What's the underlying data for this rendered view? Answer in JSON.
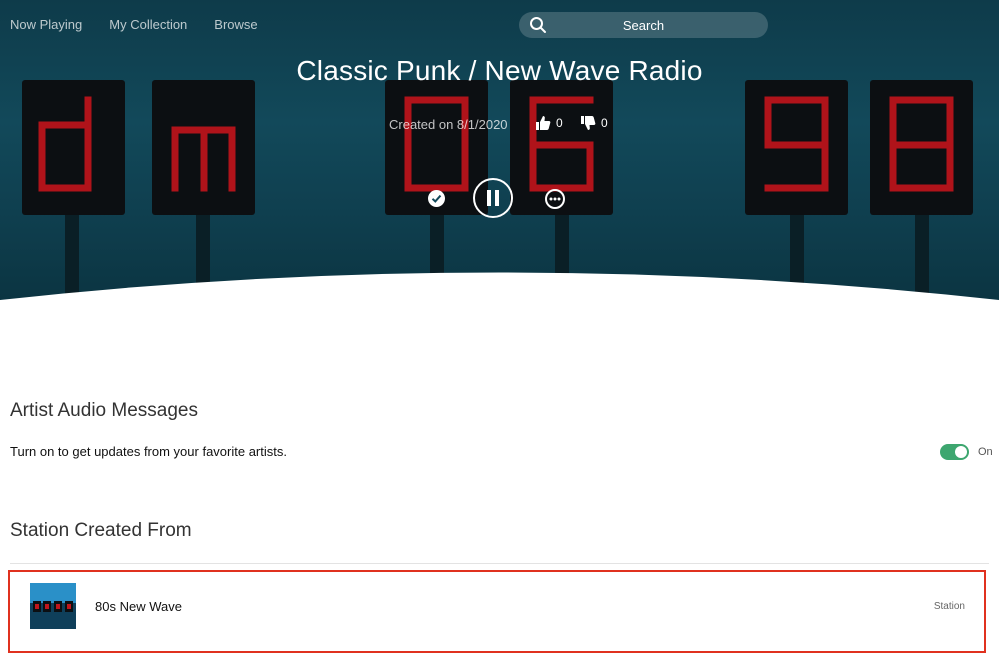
{
  "nav": {
    "items": [
      "Now Playing",
      "My Collection",
      "Browse"
    ]
  },
  "search": {
    "label": "Search"
  },
  "hero": {
    "art_text": "dm 06 98",
    "title": "Classic Punk / New Wave Radio",
    "created": "Created on 8/1/2020",
    "thumbs_up_count": "0",
    "thumbs_down_count": "0"
  },
  "controls": {
    "check_icon": "check-icon",
    "pause_icon": "pause-icon",
    "more_icon": "more-icon"
  },
  "artist_messages": {
    "title": "Artist Audio Messages",
    "description": "Turn on to get updates from your favorite artists.",
    "toggle_label": "On",
    "toggle_on": true
  },
  "station_created_from": {
    "title": "Station Created From",
    "items": [
      {
        "name": "80s New Wave",
        "type": "Station"
      }
    ]
  },
  "colors": {
    "toggle_on": "#3da66f",
    "highlight_border": "#e0311f",
    "hero_bg": "#12495a",
    "led_red": "#b0131a"
  }
}
